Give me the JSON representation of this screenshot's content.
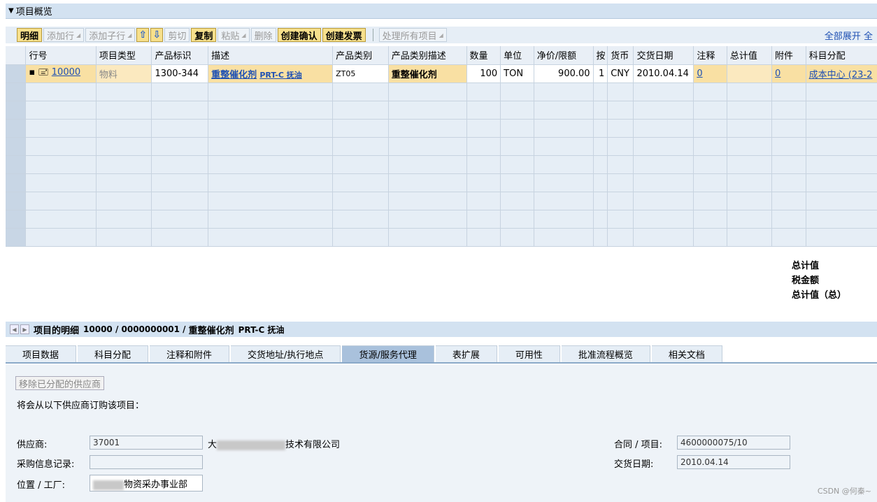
{
  "overview": {
    "title": "项目概览"
  },
  "toolbar": {
    "details": "明细",
    "add_row": "添加行",
    "add_sub_row": "添加子行",
    "cut": "剪切",
    "copy": "复制",
    "paste": "粘贴",
    "delete": "删除",
    "create_confirm": "创建确认",
    "create_invoice": "创建发票",
    "process_all": "处理所有项目",
    "expand_all": "全部展开 全"
  },
  "grid": {
    "headers": [
      "行号",
      "项目类型",
      "产品标识",
      "描述",
      "产品类别",
      "产品类别描述",
      "数量",
      "单位",
      "净价/限额",
      "按",
      "货币",
      "交货日期",
      "注释",
      "总计值",
      "附件",
      "科目分配"
    ],
    "row": {
      "line_no": "10000",
      "item_type": "物料",
      "product_id": "1300-344",
      "desc_main": "重整催化剂",
      "desc_sub": "PRT-C 抚油",
      "category": "ZT05",
      "category_desc": "重整催化剂",
      "quantity": "100",
      "unit": "TON",
      "price": "900.00",
      "per": "1",
      "currency": "CNY",
      "delivery_date": "2010.04.14",
      "notes": "0",
      "total": "",
      "attachments": "0",
      "account": "成本中心 (23-2"
    }
  },
  "totals": {
    "total": "总计值",
    "tax": "税金额",
    "gross": "总计值（总）"
  },
  "detail": {
    "title": "项目的明细",
    "ref": "10000 / 0000000001 /",
    "desc": "重整催化剂",
    "desc_sub": "PRT-C 抚油"
  },
  "tabs": [
    "项目数据",
    "科目分配",
    "注释和附件",
    "交货地址/执行地点",
    "货源/服务代理",
    "表扩展",
    "可用性",
    "批准流程概览",
    "相关文档"
  ],
  "source": {
    "remove_btn": "移除已分配的供应商",
    "info": "将会从以下供应商订购该项目：",
    "supplier_label": "供应商:",
    "supplier_value": "37001",
    "supplier_name_prefix": "大",
    "supplier_name_suffix": "技术有限公司",
    "info_record_label": "采购信息记录:",
    "info_record_value": "",
    "location_label": "位置 / 工厂:",
    "location_value": "物资采办事业部",
    "contract_label": "合同 / 项目:",
    "contract_value": "4600000075/10",
    "delivery_label": "交货日期:",
    "delivery_value": "2010.04.14"
  },
  "watermark": "CSDN @何秦~",
  "colors": {
    "header_bg": "#d3e2f1",
    "highlight_row": "#f9e0a3",
    "link": "#1e50b3",
    "active_tab": "#a9c1dc"
  }
}
